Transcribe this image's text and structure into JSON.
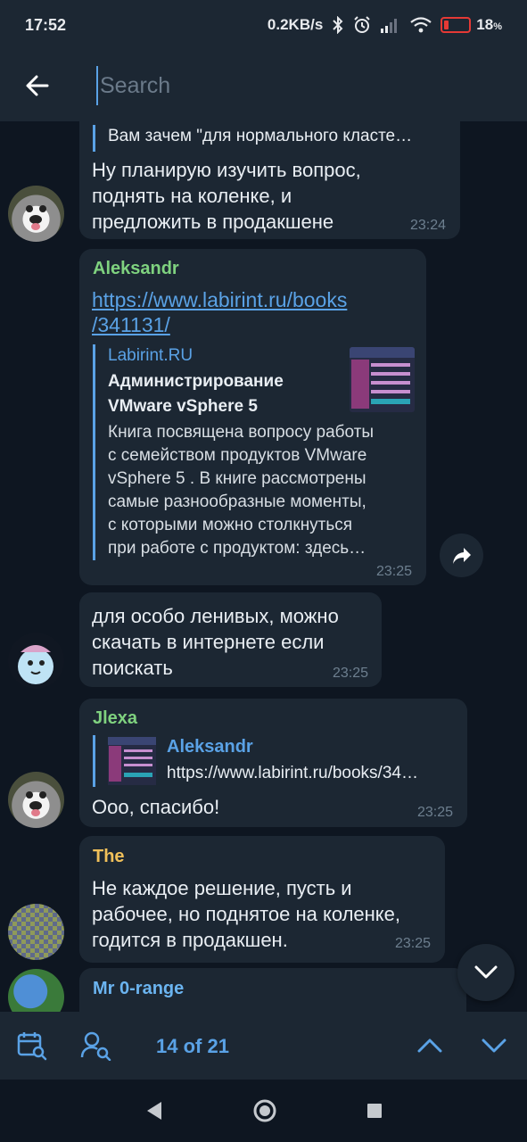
{
  "status": {
    "time": "17:52",
    "net_speed": "0.2KB/s",
    "battery": "18",
    "battery_unit": "%",
    "battery_level": 0.18
  },
  "search": {
    "placeholder": "Search"
  },
  "messages": [
    {
      "quote": "Вам зачем \"для нормального класте…",
      "text": "Ну планирую изучить вопрос,\nподнять на коленке, и\nпредложить в продакшене",
      "time": "23:24"
    },
    {
      "sender": "Aleksandr",
      "link_line1": "https://www.labirint.ru/books",
      "link_line2": "/341131/",
      "preview_site": "Labirint.RU",
      "preview_title": "Администрирование\nVMware vSphere 5",
      "preview_desc": "Книга посвящена вопросу работы\nс семейством продуктов VMware\nvSphere 5 . В книге рассмотрены\nсамые разнообразные моменты,\nс которыми можно столкнуться\nпри работе с продуктом: здесь…",
      "time": "23:25"
    },
    {
      "text": "для особо ленивых, можно\nскачать в интернете если\nпоискать",
      "time": "23:25"
    },
    {
      "sender": "Jlexa",
      "reply_name": "Aleksandr",
      "reply_text": "https://www.labirint.ru/books/34…",
      "text": "Ооо, спасибо!",
      "time": "23:25"
    },
    {
      "sender": "The",
      "text": "Не каждое решение, пусть и\nрабочее, но поднятое на коленке,\nгодится в продакшен.",
      "time": "23:25"
    },
    {
      "sender": "Mr 0-range"
    }
  ],
  "search_nav": {
    "counter": "14 of 21"
  },
  "colors": {
    "accent": "#5aa2e6",
    "sender_aleksandr": "#7fd27f",
    "sender_jlexa": "#7fd27f",
    "sender_the": "#f0c05a",
    "sender_mr": "#6bb4f0",
    "bubble": "#1c2733",
    "background": "#0e1621"
  }
}
